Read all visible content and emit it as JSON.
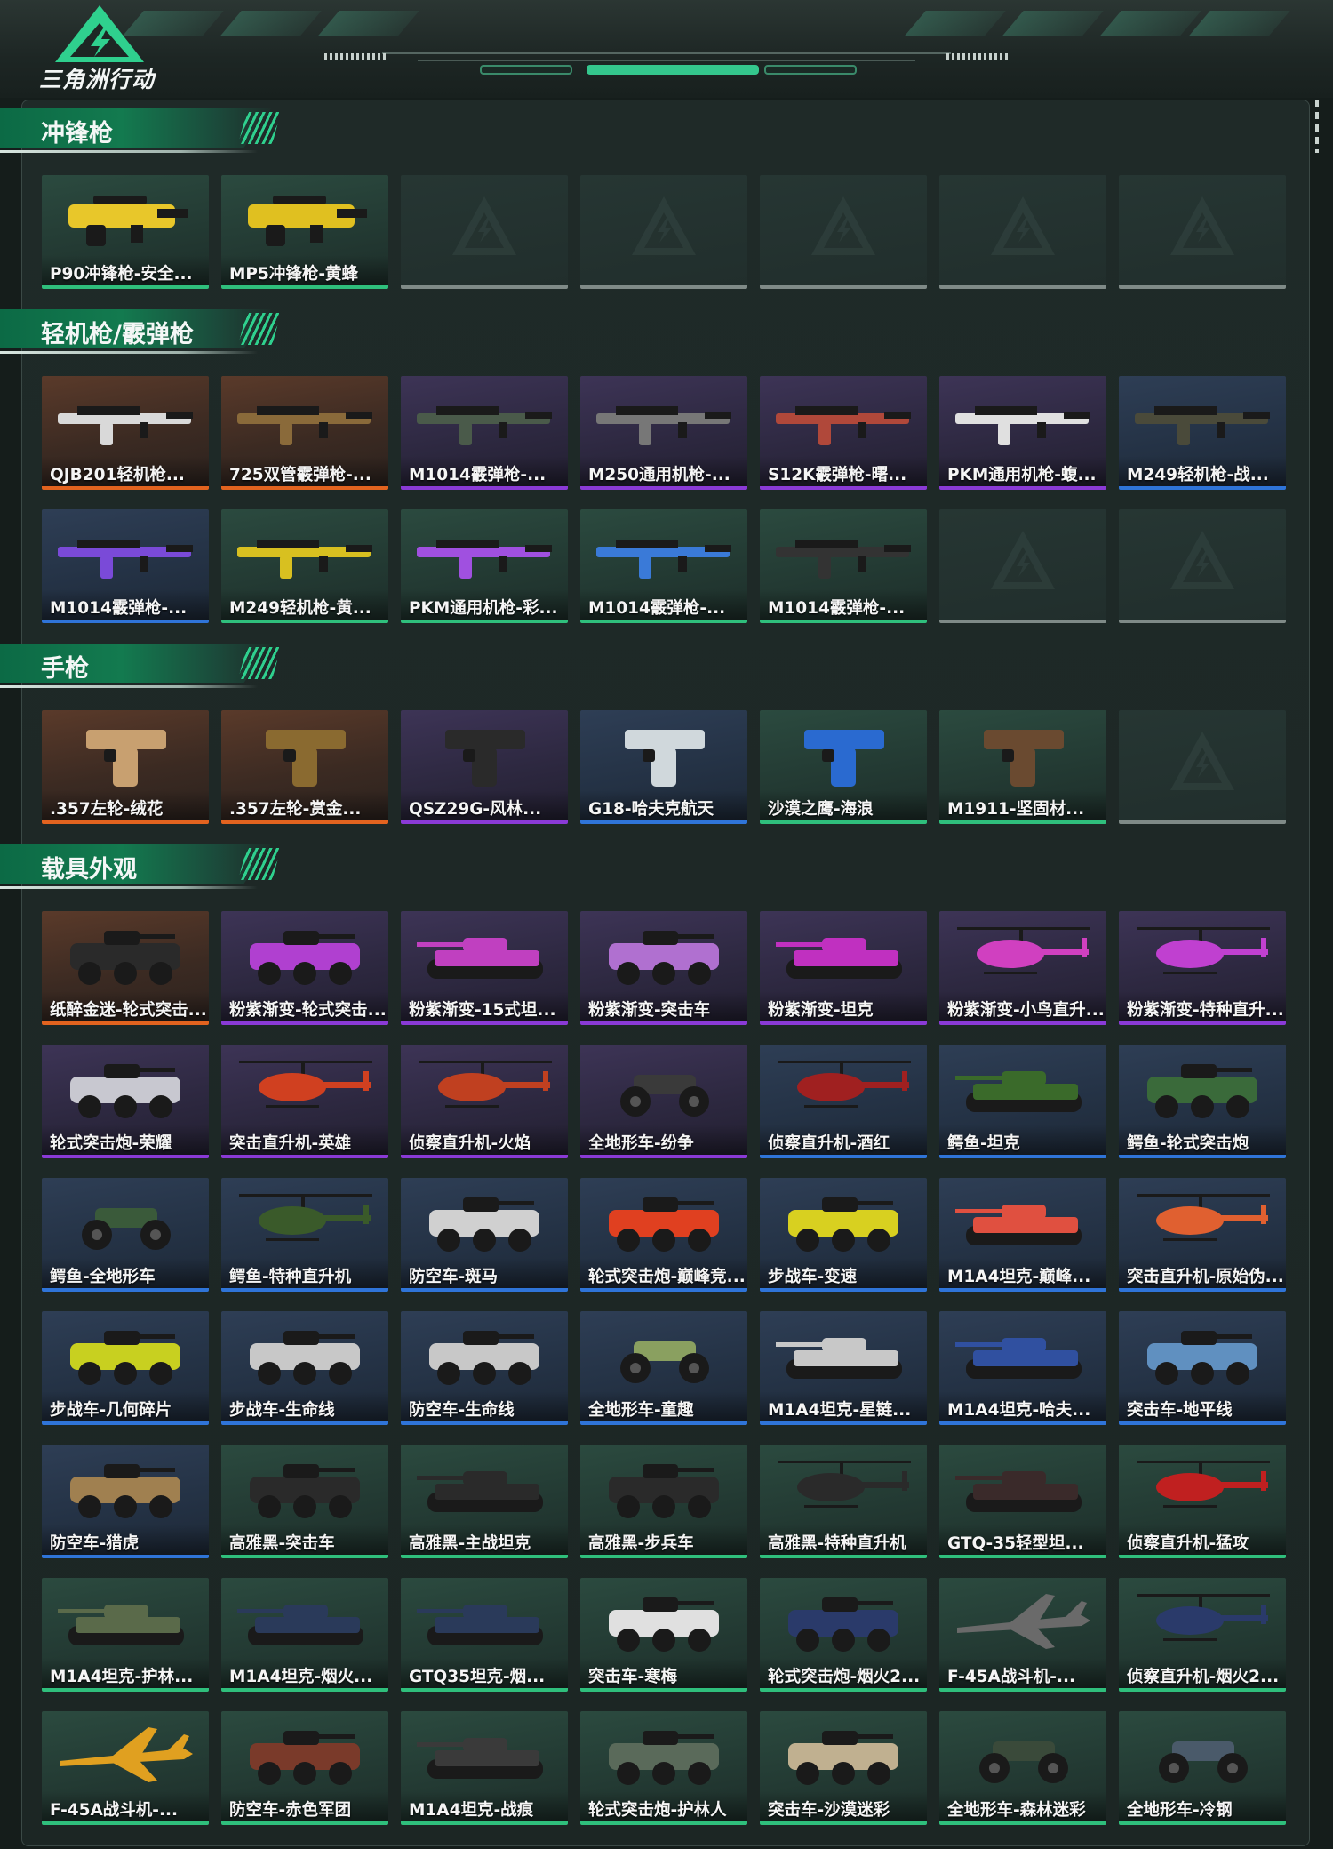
{
  "brand": {
    "logo_text": "三角洲行动",
    "accent": "#2fd08e"
  },
  "colors": {
    "orange": "#e2631f",
    "purple": "#8a3ad6",
    "blue": "#2f74d8",
    "green": "#2fbf7c",
    "empty": "#7f8a87"
  },
  "sections": [
    {
      "title": "冲锋枪",
      "items": [
        {
          "label": "P90冲锋枪-安全...",
          "tier": "green",
          "icon": "smg-icon",
          "color": "#e8c72a"
        },
        {
          "label": "MP5冲锋枪-黄蜂",
          "tier": "green",
          "icon": "smg-icon",
          "color": "#e0c020"
        },
        {
          "label": "",
          "tier": "empty"
        },
        {
          "label": "",
          "tier": "empty"
        },
        {
          "label": "",
          "tier": "empty"
        },
        {
          "label": "",
          "tier": "empty"
        },
        {
          "label": "",
          "tier": "empty"
        }
      ]
    },
    {
      "title": "轻机枪/霰弹枪",
      "items": [
        {
          "label": "QJB201轻机枪...",
          "tier": "orange",
          "icon": "rifle-icon",
          "color": "#d9d9d9"
        },
        {
          "label": "725双管霰弹枪-...",
          "tier": "orange",
          "icon": "rifle-icon",
          "color": "#8a6a3a"
        },
        {
          "label": "M1014霰弹枪-...",
          "tier": "purple",
          "icon": "rifle-icon",
          "color": "#4a5a4a"
        },
        {
          "label": "M250通用机枪-...",
          "tier": "purple",
          "icon": "rifle-icon",
          "color": "#777777"
        },
        {
          "label": "S12K霰弹枪-曙...",
          "tier": "purple",
          "icon": "rifle-icon",
          "color": "#b0483a"
        },
        {
          "label": "PKM通用机枪-蝮...",
          "tier": "purple",
          "icon": "rifle-icon",
          "color": "#e0e0e0"
        },
        {
          "label": "M249轻机枪-战...",
          "tier": "blue",
          "icon": "rifle-icon",
          "color": "#4a4a3a"
        },
        {
          "label": "M1014霰弹枪-...",
          "tier": "blue",
          "icon": "rifle-icon",
          "color": "#7a4ad8"
        },
        {
          "label": "M249轻机枪-黄...",
          "tier": "green",
          "icon": "rifle-icon",
          "color": "#d8c020"
        },
        {
          "label": "PKM通用机枪-彩...",
          "tier": "green",
          "icon": "rifle-icon",
          "color": "#a050e0"
        },
        {
          "label": "M1014霰弹枪-...",
          "tier": "green",
          "icon": "rifle-icon",
          "color": "#3a7ad8"
        },
        {
          "label": "M1014霰弹枪-...",
          "tier": "green",
          "icon": "rifle-icon",
          "color": "#333333"
        },
        {
          "label": "",
          "tier": "empty"
        },
        {
          "label": "",
          "tier": "empty"
        }
      ]
    },
    {
      "title": "手枪",
      "items": [
        {
          "label": ".357左轮-绒花",
          "tier": "orange",
          "icon": "pistol-icon",
          "color": "#c8a070"
        },
        {
          "label": ".357左轮-赏金...",
          "tier": "orange",
          "icon": "pistol-icon",
          "color": "#8a6a30"
        },
        {
          "label": "QSZ29G-风林...",
          "tier": "purple",
          "icon": "pistol-icon",
          "color": "#2a2a2a"
        },
        {
          "label": "G18-哈夫克航天",
          "tier": "blue",
          "icon": "pistol-icon",
          "color": "#d0d8dc"
        },
        {
          "label": "沙漠之鹰-海浪",
          "tier": "green",
          "icon": "pistol-icon",
          "color": "#2a6ad0"
        },
        {
          "label": "M1911-坚固材...",
          "tier": "green",
          "icon": "pistol-icon",
          "color": "#6a4a30"
        },
        {
          "label": "",
          "tier": "empty"
        }
      ]
    },
    {
      "title": "载具外观",
      "items": [
        {
          "label": "纸醉金迷-轮式突击...",
          "tier": "orange",
          "icon": "vehicle-icon",
          "color": "#2a2a2a"
        },
        {
          "label": "粉紫渐变-轮式突击...",
          "tier": "purple",
          "icon": "vehicle-icon",
          "color": "#b040d0"
        },
        {
          "label": "粉紫渐变-15式坦...",
          "tier": "purple",
          "icon": "tank-icon",
          "color": "#c040c0"
        },
        {
          "label": "粉紫渐变-突击车",
          "tier": "purple",
          "icon": "vehicle-icon",
          "color": "#b070d0"
        },
        {
          "label": "粉紫渐变-坦克",
          "tier": "purple",
          "icon": "tank-icon",
          "color": "#c030c0"
        },
        {
          "label": "粉紫渐变-小鸟直升...",
          "tier": "purple",
          "icon": "helicopter-icon",
          "color": "#d040c0"
        },
        {
          "label": "粉紫渐变-特种直升...",
          "tier": "purple",
          "icon": "helicopter-icon",
          "color": "#c040d0"
        },
        {
          "label": "轮式突击炮-荣耀",
          "tier": "purple",
          "icon": "vehicle-icon",
          "color": "#c8c8d0"
        },
        {
          "label": "突击直升机-英雄",
          "tier": "purple",
          "icon": "helicopter-icon",
          "color": "#d04020"
        },
        {
          "label": "侦察直升机-火焰",
          "tier": "purple",
          "icon": "helicopter-icon",
          "color": "#c04020"
        },
        {
          "label": "全地形车-纷争",
          "tier": "purple",
          "icon": "atv-icon",
          "color": "#3a3a3a"
        },
        {
          "label": "侦察直升机-酒红",
          "tier": "blue",
          "icon": "helicopter-icon",
          "color": "#a02020"
        },
        {
          "label": "鳄鱼-坦克",
          "tier": "blue",
          "icon": "tank-icon",
          "color": "#3a6a2a"
        },
        {
          "label": "鳄鱼-轮式突击炮",
          "tier": "blue",
          "icon": "vehicle-icon",
          "color": "#3a6a3a"
        },
        {
          "label": "鳄鱼-全地形车",
          "tier": "blue",
          "icon": "atv-icon",
          "color": "#3a5a3a"
        },
        {
          "label": "鳄鱼-特种直升机",
          "tier": "blue",
          "icon": "helicopter-icon",
          "color": "#3a5a2a"
        },
        {
          "label": "防空车-斑马",
          "tier": "blue",
          "icon": "vehicle-icon",
          "color": "#d0d0d0"
        },
        {
          "label": "轮式突击炮-巅峰竞...",
          "tier": "blue",
          "icon": "vehicle-icon",
          "color": "#e04020"
        },
        {
          "label": "步战车-变速",
          "tier": "blue",
          "icon": "vehicle-icon",
          "color": "#d8d020"
        },
        {
          "label": "M1A4坦克-巅峰...",
          "tier": "blue",
          "icon": "tank-icon",
          "color": "#e05040"
        },
        {
          "label": "突击直升机-原始伪...",
          "tier": "blue",
          "icon": "helicopter-icon",
          "color": "#e06030"
        },
        {
          "label": "步战车-几何碎片",
          "tier": "blue",
          "icon": "vehicle-icon",
          "color": "#c8d020"
        },
        {
          "label": "步战车-生命线",
          "tier": "blue",
          "icon": "vehicle-icon",
          "color": "#c8c8c8"
        },
        {
          "label": "防空车-生命线",
          "tier": "blue",
          "icon": "vehicle-icon",
          "color": "#c8c8c8"
        },
        {
          "label": "全地形车-童趣",
          "tier": "blue",
          "icon": "atv-icon",
          "color": "#8aa060"
        },
        {
          "label": "M1A4坦克-星链...",
          "tier": "blue",
          "icon": "tank-icon",
          "color": "#c8c8c8"
        },
        {
          "label": "M1A4坦克-哈夫...",
          "tier": "blue",
          "icon": "tank-icon",
          "color": "#3050a0"
        },
        {
          "label": "突击车-地平线",
          "tier": "blue",
          "icon": "vehicle-icon",
          "color": "#6090c0"
        },
        {
          "label": "防空车-猎虎",
          "tier": "blue",
          "icon": "vehicle-icon",
          "color": "#a08050"
        },
        {
          "label": "高雅黑-突击车",
          "tier": "green",
          "icon": "vehicle-icon",
          "color": "#2a2a2a"
        },
        {
          "label": "高雅黑-主战坦克",
          "tier": "green",
          "icon": "tank-icon",
          "color": "#2a2a2a"
        },
        {
          "label": "高雅黑-步兵车",
          "tier": "green",
          "icon": "vehicle-icon",
          "color": "#2a2a2a"
        },
        {
          "label": "高雅黑-特种直升机",
          "tier": "green",
          "icon": "helicopter-icon",
          "color": "#2a2a2a"
        },
        {
          "label": "GTQ-35轻型坦...",
          "tier": "green",
          "icon": "tank-icon",
          "color": "#3a2a2a"
        },
        {
          "label": "侦察直升机-猛攻",
          "tier": "green",
          "icon": "helicopter-icon",
          "color": "#c02020"
        },
        {
          "label": "M1A4坦克-护林...",
          "tier": "green",
          "icon": "tank-icon",
          "color": "#5a6a4a"
        },
        {
          "label": "M1A4坦克-烟火...",
          "tier": "green",
          "icon": "tank-icon",
          "color": "#2a3a5a"
        },
        {
          "label": "GTQ35坦克-烟...",
          "tier": "green",
          "icon": "tank-icon",
          "color": "#2a3a5a"
        },
        {
          "label": "突击车-寒梅",
          "tier": "green",
          "icon": "vehicle-icon",
          "color": "#e0e0e0"
        },
        {
          "label": "轮式突击炮-烟火2...",
          "tier": "green",
          "icon": "vehicle-icon",
          "color": "#2a3a6a"
        },
        {
          "label": "F-45A战斗机-...",
          "tier": "green",
          "icon": "jet-icon",
          "color": "#6a6a6a"
        },
        {
          "label": "侦察直升机-烟火2...",
          "tier": "green",
          "icon": "helicopter-icon",
          "color": "#2a3a6a"
        },
        {
          "label": "F-45A战斗机-...",
          "tier": "green",
          "icon": "jet-icon",
          "color": "#e0a020"
        },
        {
          "label": "防空车-赤色军团",
          "tier": "green",
          "icon": "vehicle-icon",
          "color": "#7a3a2a"
        },
        {
          "label": "M1A4坦克-战痕",
          "tier": "green",
          "icon": "tank-icon",
          "color": "#3a3a3a"
        },
        {
          "label": "轮式突击炮-护林人",
          "tier": "green",
          "icon": "vehicle-icon",
          "color": "#5a6a5a"
        },
        {
          "label": "突击车-沙漠迷彩",
          "tier": "green",
          "icon": "vehicle-icon",
          "color": "#c0b090"
        },
        {
          "label": "全地形车-森林迷彩",
          "tier": "green",
          "icon": "atv-icon",
          "color": "#3a4a3a"
        },
        {
          "label": "全地形车-冷钢",
          "tier": "green",
          "icon": "atv-icon",
          "color": "#4a5a6a"
        }
      ]
    }
  ]
}
